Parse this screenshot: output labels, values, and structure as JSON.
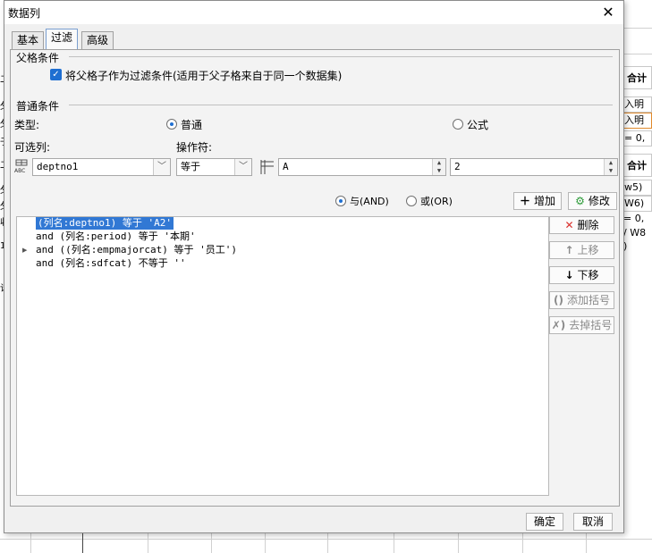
{
  "background": {
    "right_cells": [
      "合计",
      "入明",
      "入明",
      "= 0,",
      "合计",
      "w5)",
      "W6)",
      "= 0,",
      "/ W8",
      ")"
    ],
    "left_cells": [
      "二",
      "攵",
      "攵",
      "子",
      "二",
      "攵",
      "攵",
      "收",
      "1"
    ],
    "left_fragment": "计"
  },
  "dialog": {
    "title": "数据列",
    "tabs": [
      "基本",
      "过滤",
      "高级"
    ],
    "parent": {
      "section_title": "父格条件",
      "checkbox_label": "将父格子作为过滤条件(适用于父子格来自于同一个数据集)",
      "checked": true
    },
    "common": {
      "section_title": "普通条件",
      "type_label": "类型:",
      "type_options": [
        "普通",
        "公式"
      ],
      "type_selected": "普通",
      "column_label": "可选列:",
      "operator_label": "操作符:",
      "column_value": "deptno1",
      "operator_value": "等于",
      "value_text": "A",
      "value_number": "2"
    },
    "logic": {
      "and_label": "与(AND)",
      "or_label": "或(OR)",
      "selected": "and",
      "add_button": "增加",
      "modify_button": "修改"
    },
    "conditions": [
      {
        "text": "(列名:deptno1) 等于 'A2'",
        "selected": true,
        "expandable": false
      },
      {
        "text": "and (列名:period) 等于 '本期'",
        "selected": false,
        "expandable": false
      },
      {
        "text": "and ((列名:empmajorcat) 等于 '员工')",
        "selected": false,
        "expandable": true
      },
      {
        "text": "and (列名:sdfcat) 不等于 ''",
        "selected": false,
        "expandable": false
      }
    ],
    "side_buttons": {
      "delete": "删除",
      "move_up": "上移",
      "move_down": "下移",
      "add_bracket": "添加括号",
      "remove_bracket": "去掉括号"
    },
    "footer": {
      "ok": "确定",
      "cancel": "取消"
    },
    "colors": {
      "selection": "#3178d4",
      "checkbox": "#1f6fd1",
      "delete_icon": "#d9302c",
      "modify_icon": "#2e9b3a"
    }
  }
}
